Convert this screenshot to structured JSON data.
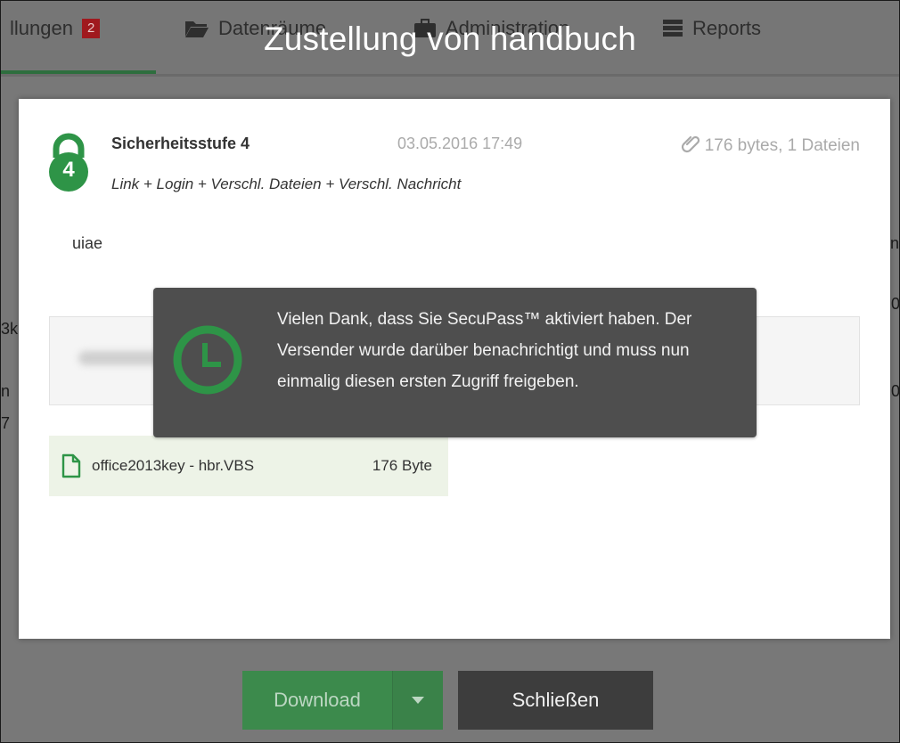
{
  "nav": {
    "items": [
      {
        "label": "llungen",
        "badge": "2",
        "icon": "inbox-icon"
      },
      {
        "label": "Datenräume",
        "icon": "folder-icon"
      },
      {
        "label": "Administration",
        "icon": "briefcase-icon"
      },
      {
        "label": "Reports",
        "icon": "server-icon"
      }
    ]
  },
  "modal": {
    "title": "Zustellung von handbuch",
    "security_level": "Sicherheitsstufe 4",
    "lock_number": "4",
    "date": "03.05.2016 17:49",
    "meta": "176 bytes, 1 Dateien",
    "description": "Link + Login + Verschl. Dateien + Verschl. Nachricht",
    "message": "uiae",
    "file": {
      "name": "office2013key - hbr.VBS",
      "size": "176 Byte"
    }
  },
  "toast": {
    "text": "Vielen Dank, dass Sie SecuPass™ aktiviert haben. Der Versender wurde darüber benachrichtigt und muss nun einmalig diesen ersten Zugriff freigeben."
  },
  "footer": {
    "download_label": "Download",
    "close_label": "Schließen"
  },
  "background": {
    "glyphs": [
      "n",
      "7",
      "3k",
      "0",
      "0",
      "n"
    ]
  },
  "colors": {
    "green": "#3c8a4c",
    "lock_green": "#2e9447",
    "toast_bg": "#4e4e4e",
    "badge_red": "#a0191e"
  }
}
